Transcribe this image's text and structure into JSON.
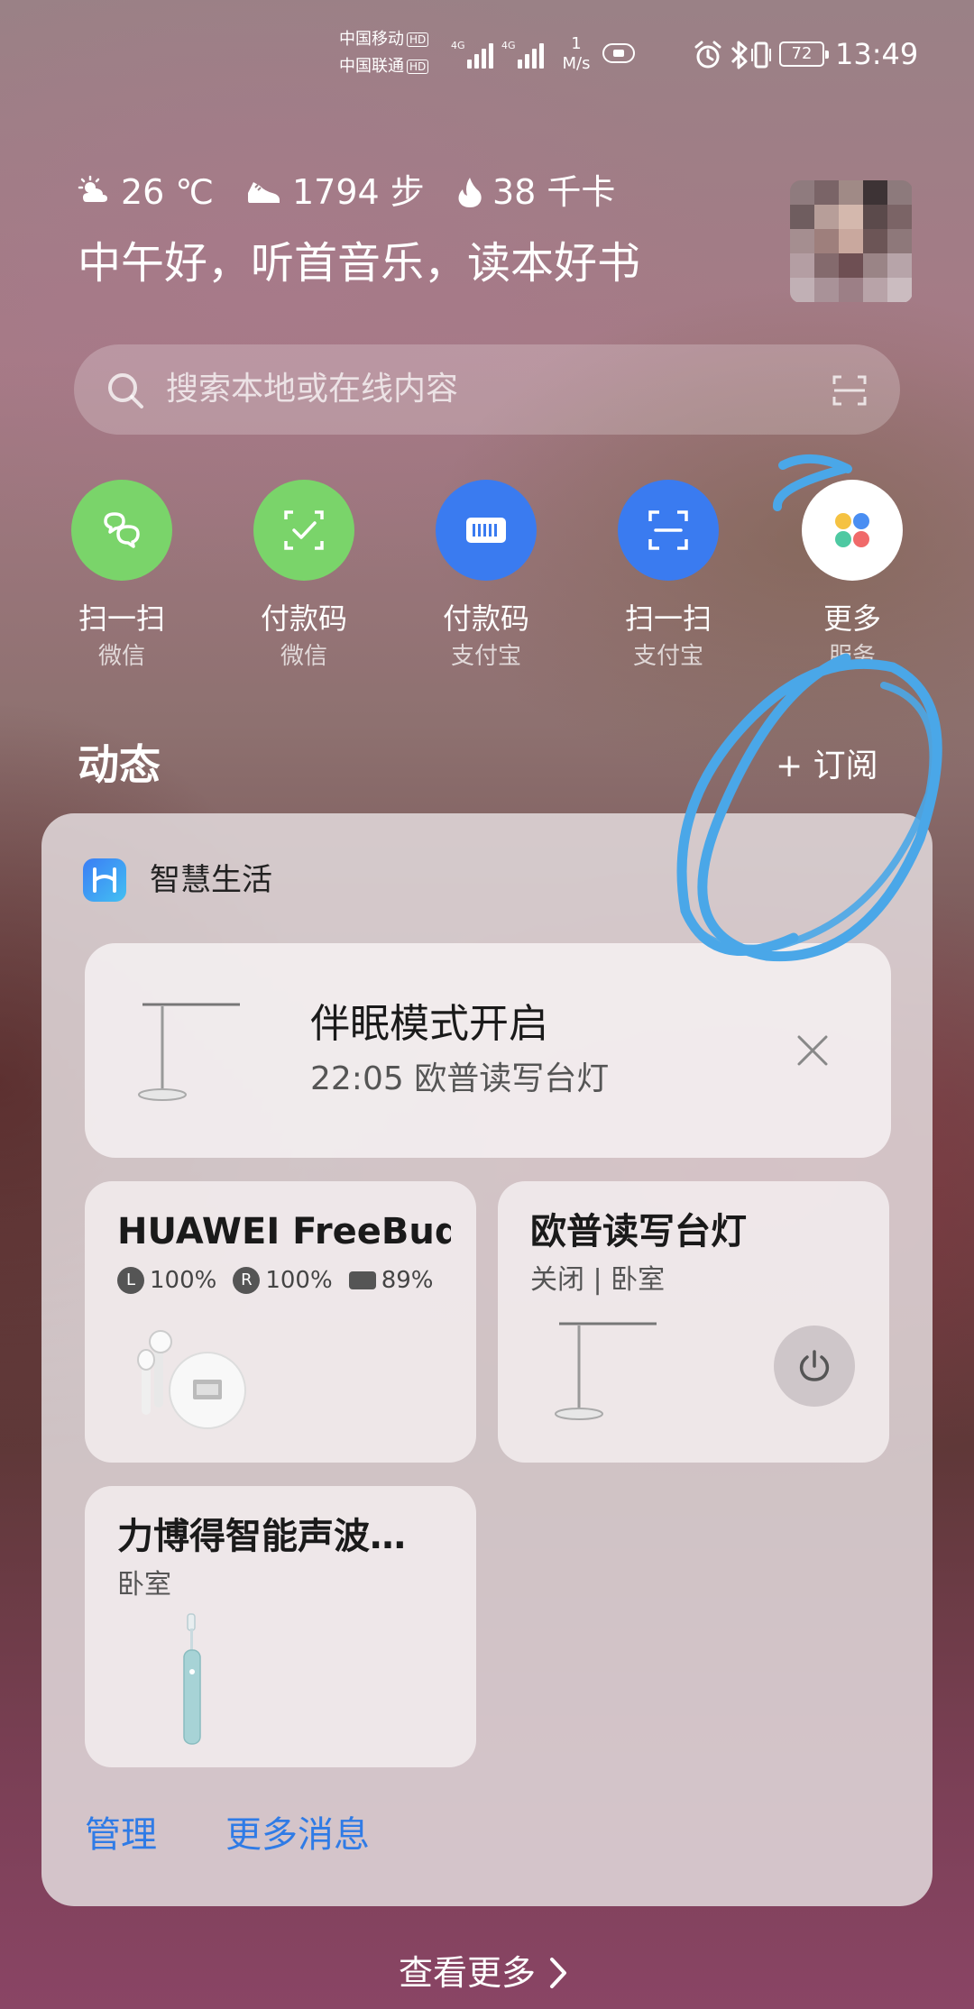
{
  "status_bar": {
    "carrier_1": "中国移动",
    "carrier_2": "中国联通",
    "hd_badge": "HD",
    "network_type": "4G",
    "net_speed_value": "1",
    "net_speed_unit": "M/s",
    "battery_level": "72",
    "time": "13:49",
    "icons": [
      "signal-icon",
      "hotspot-icon",
      "alarm-icon",
      "bluetooth-icon",
      "vibrate-icon",
      "battery-icon"
    ]
  },
  "greeting": {
    "weather": "26 ℃",
    "steps": "1794 步",
    "calories": "38 千卡",
    "message": "中午好，听首音乐，读本好书"
  },
  "search": {
    "placeholder": "搜索本地或在线内容"
  },
  "quick_actions": [
    {
      "label": "扫一扫",
      "sub": "微信",
      "color": "#7ad46a",
      "icon": "wechat-scan-icon"
    },
    {
      "label": "付款码",
      "sub": "微信",
      "color": "#7ad46a",
      "icon": "wechat-pay-icon"
    },
    {
      "label": "付款码",
      "sub": "支付宝",
      "color": "#3a7bf0",
      "icon": "alipay-pay-icon"
    },
    {
      "label": "扫一扫",
      "sub": "支付宝",
      "color": "#3a7bf0",
      "icon": "alipay-scan-icon"
    },
    {
      "label": "更多",
      "sub": "服务",
      "color": "#ffffff",
      "icon": "more-apps-icon"
    }
  ],
  "feed": {
    "title": "动态",
    "subscribe": "+ 订阅"
  },
  "card": {
    "title": "智慧生活",
    "notice": {
      "title": "伴眠模式开启",
      "subtitle": "22:05 欧普读写台灯"
    },
    "devices": [
      {
        "name": "HUAWEI FreeBud…",
        "battery_left_label": "L",
        "battery_left": "100%",
        "battery_right_label": "R",
        "battery_right": "100%",
        "battery_case": "89%"
      },
      {
        "name": "欧普读写台灯",
        "meta": "关闭 | 卧室"
      },
      {
        "name": "力博得智能声波…",
        "meta": "卧室"
      }
    ],
    "links": {
      "manage": "管理",
      "more_messages": "更多消息"
    }
  },
  "footer": {
    "see_more": "查看更多"
  },
  "colors": {
    "link_blue": "#2f7be6",
    "annotation_blue": "#4aa7e8",
    "wechat_green": "#7ad46a",
    "alipay_blue": "#3a7bf0"
  }
}
